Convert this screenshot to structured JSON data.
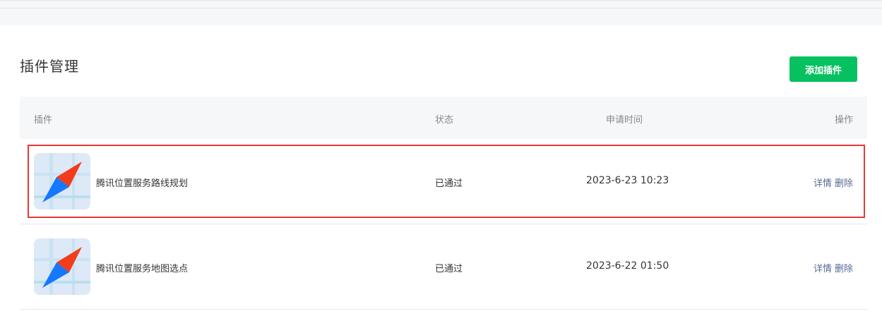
{
  "header": {
    "title": "插件管理",
    "add_button_label": "添加插件"
  },
  "table": {
    "columns": {
      "plugin": "插件",
      "status": "状态",
      "time": "申请时间",
      "actions": "操作"
    },
    "rows": [
      {
        "name": "腾讯位置服务路线规划",
        "status": "已通过",
        "time": "2023-6-23 10:23",
        "detail": "详情",
        "delete": "删除",
        "highlighted": true
      },
      {
        "name": "腾讯位置服务地图选点",
        "status": "已通过",
        "time": "2023-6-22 01:50",
        "detail": "详情",
        "delete": "删除",
        "highlighted": false
      }
    ]
  },
  "colors": {
    "accent": "#07c160",
    "link": "#576b95",
    "highlight_border": "#e53935"
  },
  "icons": {
    "plugin_icon": "compass-map-icon"
  }
}
